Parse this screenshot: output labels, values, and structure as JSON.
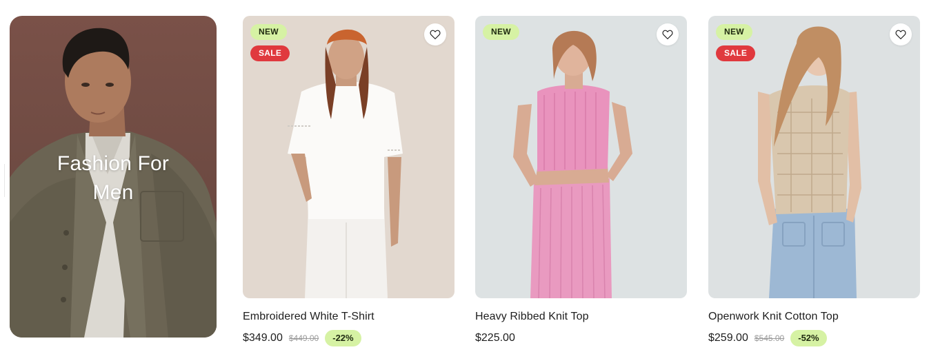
{
  "promo": {
    "title": "Fashion For Men",
    "background": "#6f4b43"
  },
  "products": [
    {
      "name": "Embroidered White T-Shirt",
      "price": "$349.00",
      "old_price": "$449.00",
      "discount": "-22%",
      "badges": [
        "NEW",
        "SALE"
      ],
      "image_bg": "#e2d8cf"
    },
    {
      "name": "Heavy Ribbed Knit Top",
      "price": "$225.00",
      "badges": [
        "NEW"
      ],
      "image_bg": "#dde2e3"
    },
    {
      "name": "Openwork Knit Cotton Top",
      "price": "$259.00",
      "old_price": "$545.00",
      "discount": "-52%",
      "badges": [
        "NEW",
        "SALE"
      ],
      "image_bg": "#dde1e2"
    }
  ],
  "colors": {
    "badge_new": "#d6f2a4",
    "badge_sale": "#e0393e",
    "discount_pill": "#d6f2a4"
  },
  "icons": {
    "wishlist": "heart-outline-icon"
  }
}
